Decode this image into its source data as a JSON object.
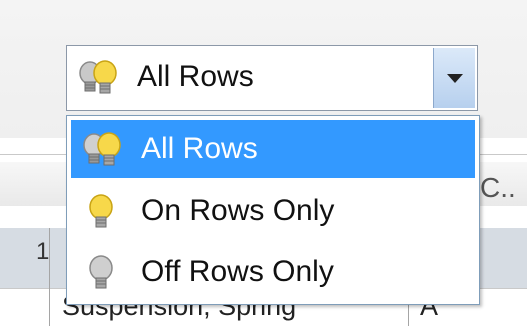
{
  "combo": {
    "selected_label": "All Rows",
    "selected_icon": "lightbulbs-on-off-icon"
  },
  "dropdown": {
    "options": [
      {
        "label": "All Rows",
        "icon": "lightbulbs-on-off-icon",
        "selected": true
      },
      {
        "label": "On Rows Only",
        "icon": "lightbulb-on-icon",
        "selected": false
      },
      {
        "label": "Off Rows Only",
        "icon": "lightbulb-off-icon",
        "selected": false
      }
    ]
  },
  "background": {
    "header_hint": "C..",
    "row_number": "1",
    "cell_text": "Suspension, Spring",
    "cell_text_2": "A"
  },
  "colors": {
    "selection": "#3399ff",
    "bulb_on": "#f7d84a",
    "bulb_off": "#b8b8b8"
  }
}
